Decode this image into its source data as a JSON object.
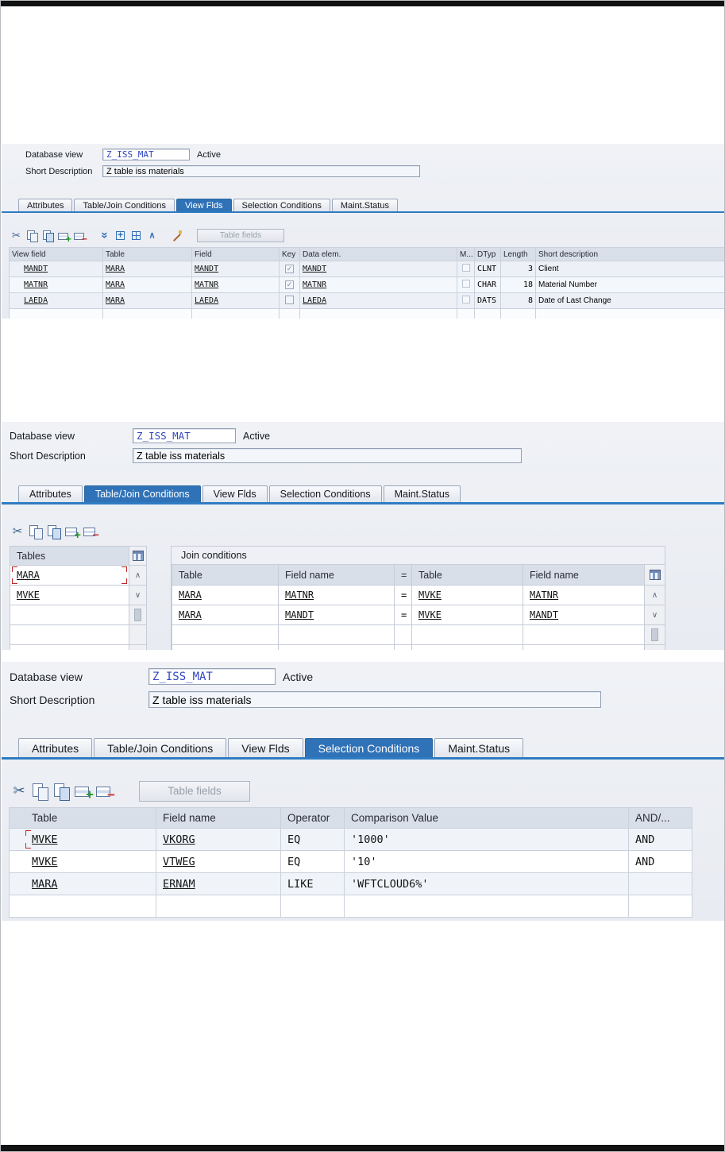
{
  "colors": {
    "active_tab": "#2f72b7",
    "tab_underline": "#2e7cc2",
    "header_bg": "#d9dfe9",
    "selection_red": "#c22727",
    "field_value_blue": "#3046c0"
  },
  "panel1": {
    "db_view_label": "Database view",
    "db_view_value": "Z_ISS_MAT",
    "status": "Active",
    "short_desc_label": "Short Description",
    "short_desc_value": "Z table iss materials",
    "tabs": [
      "Attributes",
      "Table/Join Conditions",
      "View Flds",
      "Selection Conditions",
      "Maint.Status"
    ],
    "active_tab": "View Flds",
    "toolbar_icons": [
      "cut-icon",
      "copy-icon",
      "paste-icon",
      "insert-row-icon",
      "delete-row-icon",
      "filter-icon",
      "expand-icon",
      "block-select-icon",
      "move-up-icon",
      "wand-icon"
    ],
    "table_fields_button": "Table fields",
    "columns": [
      "View field",
      "Table",
      "Field",
      "Key",
      "Data elem.",
      "M...",
      "DTyp",
      "Length",
      "Short description"
    ],
    "rows": [
      {
        "view_field": "MANDT",
        "table": "MARA",
        "field": "MANDT",
        "key": "✓",
        "data_elem": "MANDT",
        "m": "",
        "dtyp": "CLNT",
        "length": "3",
        "short_description": "Client"
      },
      {
        "view_field": "MATNR",
        "table": "MARA",
        "field": "MATNR",
        "key": "✓",
        "data_elem": "MATNR",
        "m": "",
        "dtyp": "CHAR",
        "length": "18",
        "short_description": "Material Number"
      },
      {
        "view_field": "LAEDA",
        "table": "MARA",
        "field": "LAEDA",
        "key": "",
        "data_elem": "LAEDA",
        "m": "",
        "dtyp": "DATS",
        "length": "8",
        "short_description": "Date of Last Change"
      }
    ]
  },
  "panel2": {
    "db_view_label": "Database view",
    "db_view_value": "Z_ISS_MAT",
    "status": "Active",
    "short_desc_label": "Short Description",
    "short_desc_value": "Z table iss materials",
    "tabs": [
      "Attributes",
      "Table/Join Conditions",
      "View Flds",
      "Selection Conditions",
      "Maint.Status"
    ],
    "active_tab": "Table/Join Conditions",
    "toolbar_icons": [
      "cut-icon",
      "copy-icon",
      "paste-icon",
      "insert-row-icon",
      "delete-row-icon"
    ],
    "tables_title": "Tables",
    "tables": [
      "MARA",
      "MVKE"
    ],
    "join_title": "Join conditions",
    "join_columns": [
      "Table",
      "Field name",
      "=",
      "Table",
      "Field name"
    ],
    "join_rows": [
      {
        "t1": "MARA",
        "f1": "MATNR",
        "eq": "=",
        "t2": "MVKE",
        "f2": "MATNR"
      },
      {
        "t1": "MARA",
        "f1": "MANDT",
        "eq": "=",
        "t2": "MVKE",
        "f2": "MANDT"
      }
    ]
  },
  "panel3": {
    "db_view_label": "Database view",
    "db_view_value": "Z_ISS_MAT",
    "status": "Active",
    "short_desc_label": "Short Description",
    "short_desc_value": "Z table iss materials",
    "tabs": [
      "Attributes",
      "Table/Join Conditions",
      "View Flds",
      "Selection Conditions",
      "Maint.Status"
    ],
    "active_tab": "Selection Conditions",
    "toolbar_icons": [
      "cut-icon",
      "copy-icon",
      "paste-icon",
      "insert-row-icon",
      "delete-row-icon"
    ],
    "table_fields_button": "Table fields",
    "columns": [
      "Table",
      "Field name",
      "Operator",
      "Comparison Value",
      "AND/..."
    ],
    "rows": [
      {
        "table": "MVKE",
        "field": "VKORG",
        "operator": "EQ",
        "value": "'1000'",
        "andor": "AND"
      },
      {
        "table": "MVKE",
        "field": "VTWEG",
        "operator": "EQ",
        "value": "'10'",
        "andor": "AND"
      },
      {
        "table": "MARA",
        "field": "ERNAM",
        "operator": "LIKE",
        "value": "'WFTCLOUD6%'",
        "andor": ""
      }
    ]
  }
}
